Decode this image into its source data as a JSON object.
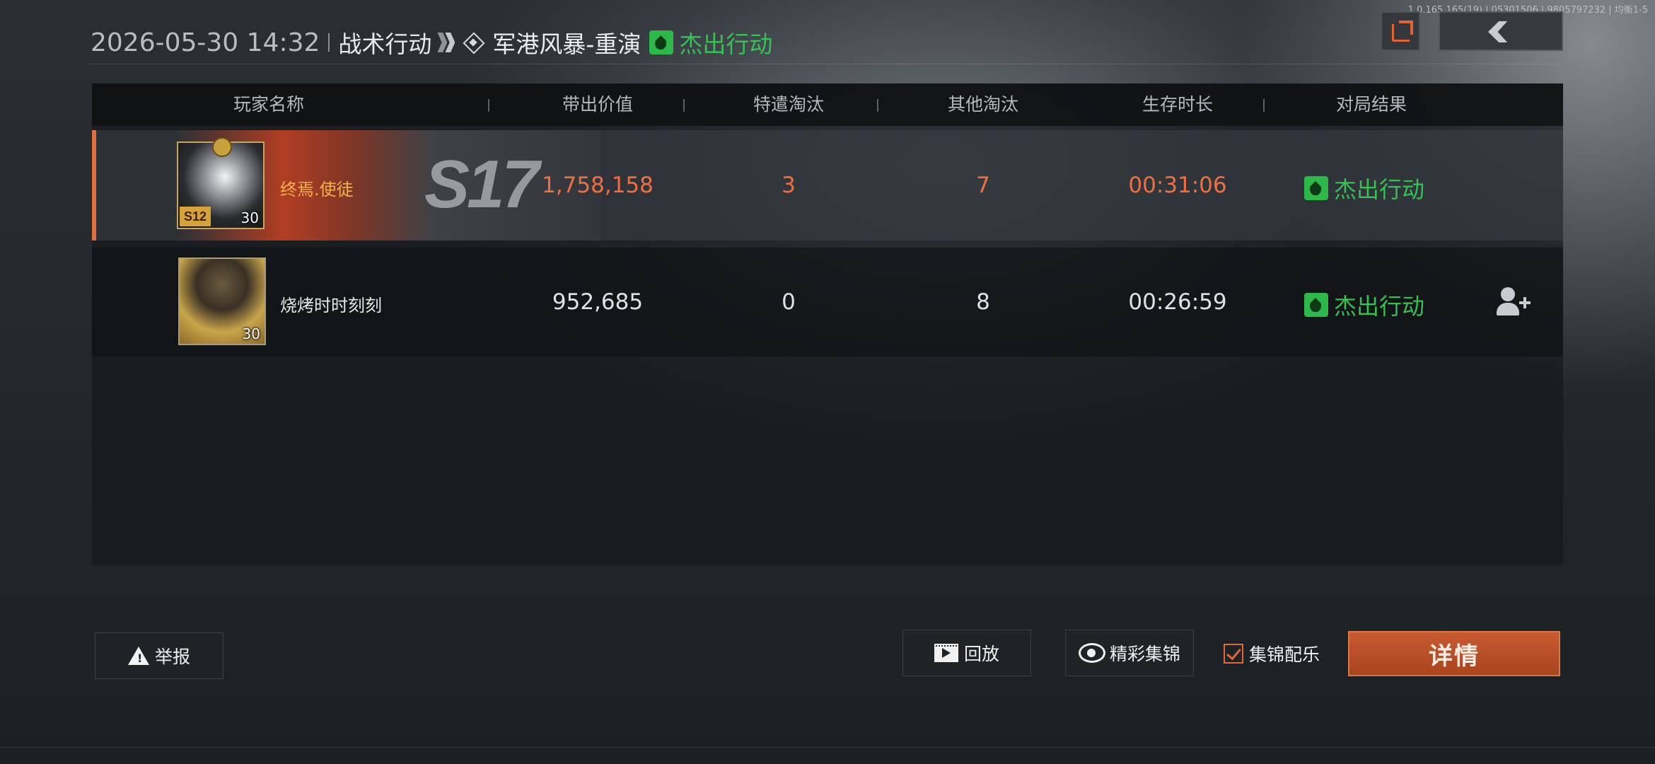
{
  "build_info": "1.0.165.165(19) | 05301506 | 9805797232 | 均衡1-5",
  "header": {
    "datetime": "2026-05-30 14:32",
    "mode": "战术行动",
    "map": "军港风暴-重演",
    "result": "杰出行动"
  },
  "table": {
    "columns": [
      "玩家名称",
      "带出价值",
      "特遣淘汰",
      "其他淘汰",
      "生存时长",
      "对局结果"
    ],
    "rows": [
      {
        "player": "终焉.使徒",
        "avatar_tag": "S12",
        "level": "30",
        "season_badge": "S17",
        "value": "1,758,158",
        "special_elims": "3",
        "other_elims": "7",
        "survival": "00:31:06",
        "result": "杰出行动",
        "is_self": true
      },
      {
        "player": "烧烤时时刻刻",
        "level": "30",
        "value": "952,685",
        "special_elims": "0",
        "other_elims": "8",
        "survival": "00:26:59",
        "result": "杰出行动",
        "is_self": false
      }
    ]
  },
  "footer": {
    "report": "举报",
    "replay": "回放",
    "highlights": "精彩集锦",
    "highlight_music": "集锦配乐",
    "highlight_music_checked": true,
    "details": "详情"
  },
  "icons": {
    "share": "share-icon",
    "back": "back-icon",
    "result": "outstanding-result-icon",
    "add_friend": "add-friend-icon",
    "warning": "warning-icon",
    "film": "film-icon",
    "camera": "camera-icon"
  },
  "colors": {
    "accent": "#e0703e",
    "success": "#37c153",
    "highlight_name": "#f0b24a",
    "detail_button": "#b84f26"
  }
}
